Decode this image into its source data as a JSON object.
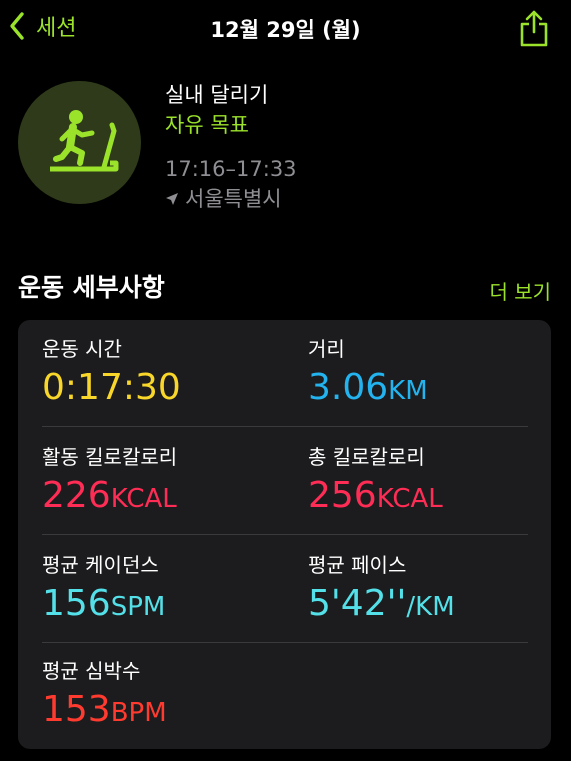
{
  "nav": {
    "back_label": "세션",
    "title": "12월 29일 (월)"
  },
  "workout": {
    "name": "실내 달리기",
    "goal": "자유 목표",
    "time_range": "17:16–17:33",
    "location": "서울특별시"
  },
  "section": {
    "title": "운동 세부사항",
    "more_label": "더 보기"
  },
  "metrics": {
    "duration": {
      "label": "운동 시간",
      "value": "0:17:30",
      "unit": ""
    },
    "distance": {
      "label": "거리",
      "value": "3.06",
      "unit": "KM"
    },
    "active_cal": {
      "label": "활동 킬로칼로리",
      "value": "226",
      "unit": "KCAL"
    },
    "total_cal": {
      "label": "총 킬로칼로리",
      "value": "256",
      "unit": "KCAL"
    },
    "cadence": {
      "label": "평균 케이던스",
      "value": "156",
      "unit": "SPM"
    },
    "pace": {
      "label": "평균 페이스",
      "value": "5'42''",
      "unit": "/KM"
    },
    "heart_rate": {
      "label": "평균 심박수",
      "value": "153",
      "unit": "BPM"
    }
  },
  "colors": {
    "accent": "#9be22b",
    "duration": "#f9d72a",
    "distance": "#23b4f0",
    "calories": "#ff2d55",
    "cadence": "#54e0e8",
    "heart_rate": "#ff3b30"
  },
  "icons": {
    "back": "chevron-left-icon",
    "share": "share-icon",
    "workout": "treadmill-runner-icon",
    "location": "location-arrow-icon"
  }
}
